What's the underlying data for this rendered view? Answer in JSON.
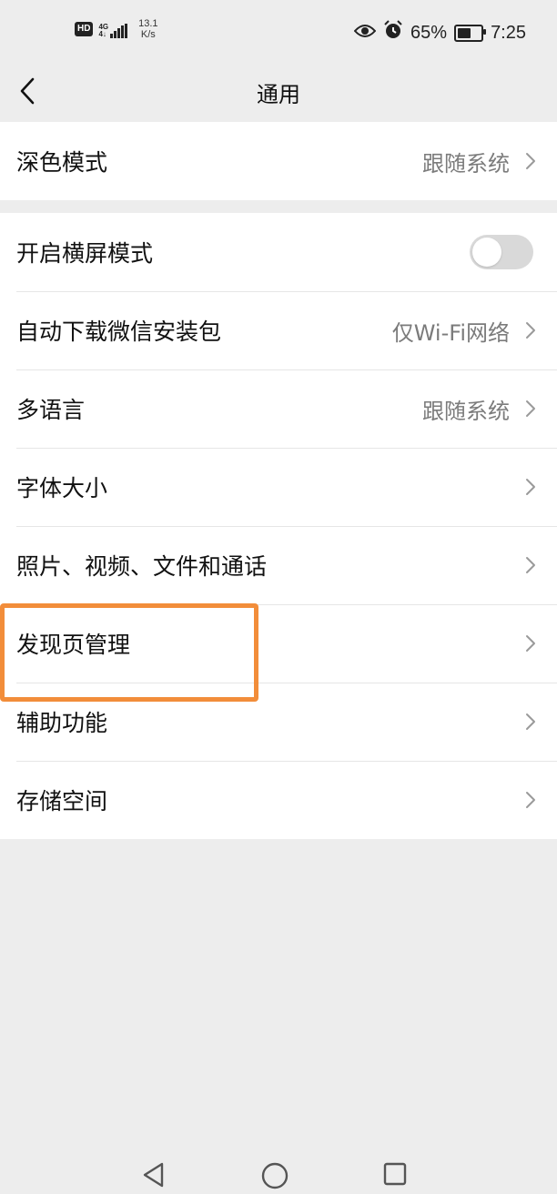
{
  "status_bar": {
    "hd": "HD",
    "net_top": "4G",
    "net_bottom": "4↓",
    "speed_value": "13.1",
    "speed_unit": "K/s",
    "battery_percent": "65%",
    "battery_level": 0.65,
    "time": "7:25",
    "icons": [
      "eye-icon",
      "alarm-icon",
      "battery-icon"
    ]
  },
  "header": {
    "title": "通用",
    "back_icon": "chevron-left-icon"
  },
  "groups": [
    {
      "items": [
        {
          "label": "深色模式",
          "value": "跟随系统",
          "type": "link"
        }
      ]
    },
    {
      "items": [
        {
          "label": "开启横屏模式",
          "type": "toggle",
          "on": false
        },
        {
          "label": "自动下载微信安装包",
          "value": "仅Wi-Fi网络",
          "type": "link"
        },
        {
          "label": "多语言",
          "value": "跟随系统",
          "type": "link"
        },
        {
          "label": "字体大小",
          "type": "link"
        },
        {
          "label": "照片、视频、文件和通话",
          "type": "link"
        },
        {
          "label": "发现页管理",
          "type": "link",
          "highlighted": true
        },
        {
          "label": "辅助功能",
          "type": "link"
        },
        {
          "label": "存储空间",
          "type": "link"
        }
      ]
    }
  ],
  "highlight_color": "#f28d3a",
  "system_nav": [
    "back-triangle-icon",
    "home-circle-icon",
    "recents-square-icon"
  ]
}
